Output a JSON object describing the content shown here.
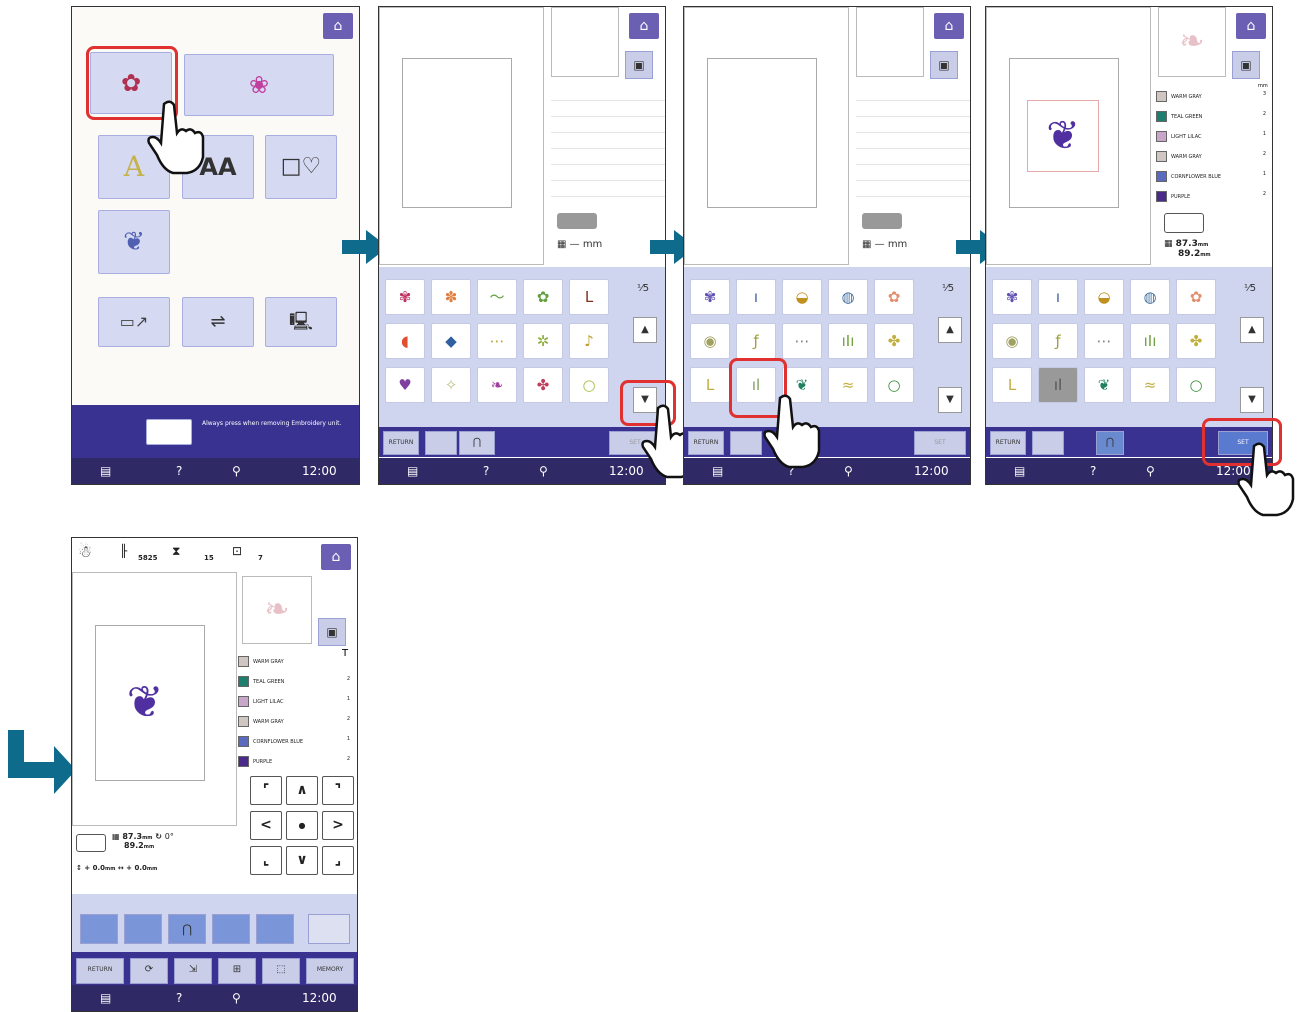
{
  "statusbar": {
    "help": "?",
    "time": "12:00",
    "foot_icon": "presser-foot-icon"
  },
  "screen1": {
    "notice_text": "Always press when removing Embroidery unit.",
    "buttons": [
      "embroidery-pattern",
      "frame-pattern",
      "alphabet",
      "character-font",
      "frame-shape",
      "monogram",
      "embroidery-card",
      "usb",
      "computer"
    ]
  },
  "screen2": {
    "size_dash": "— mm",
    "page_label": "5",
    "buttons": {
      "return": "RETURN",
      "set": "SET"
    }
  },
  "screen4": {
    "threads_header": "mm",
    "threads": [
      {
        "name": "WARM GRAY",
        "count": "3",
        "color": "#cfc6c1"
      },
      {
        "name": "TEAL GREEN",
        "count": "2",
        "color": "#1f7f6e"
      },
      {
        "name": "LIGHT LILAC",
        "count": "1",
        "color": "#c8a6c9"
      },
      {
        "name": "WARM GRAY",
        "count": "2",
        "color": "#cfc6c1"
      },
      {
        "name": "CORNFLOWER BLUE",
        "count": "1",
        "color": "#5a6bbf"
      },
      {
        "name": "PURPLE",
        "count": "2",
        "color": "#4b2b8a"
      }
    ],
    "width": "87.3",
    "height": "89.2",
    "unit": "mm",
    "return": "RETURN",
    "set": "SET"
  },
  "screen5": {
    "stitch_count": "5825",
    "time": "15",
    "color_count": "7",
    "threads": [
      {
        "name": "WARM GRAY",
        "count": "",
        "color": "#cfc6c1"
      },
      {
        "name": "TEAL GREEN",
        "count": "2",
        "color": "#1f7f6e"
      },
      {
        "name": "LIGHT LILAC",
        "count": "1",
        "color": "#c8a6c9"
      },
      {
        "name": "WARM GRAY",
        "count": "2",
        "color": "#cfc6c1"
      },
      {
        "name": "CORNFLOWER BLUE",
        "count": "1",
        "color": "#5a6bbf"
      },
      {
        "name": "PURPLE",
        "count": "2",
        "color": "#4b2b8a"
      }
    ],
    "width": "87.3",
    "height": "89.2",
    "angle": "0°",
    "offset_v": "0.0",
    "offset_h": "0.0",
    "unit": "mm",
    "dir_buttons": [
      "⌜",
      "∧",
      "⌝",
      "<",
      "●",
      ">",
      "⌞",
      "∨",
      "⌟"
    ],
    "return": "RETURN",
    "memory": "MEMORY"
  },
  "colors": {
    "nav": "#2f2a66",
    "panel": "#cfd4ef",
    "highlight": "#e03030",
    "arrow": "#0e6b8c"
  }
}
